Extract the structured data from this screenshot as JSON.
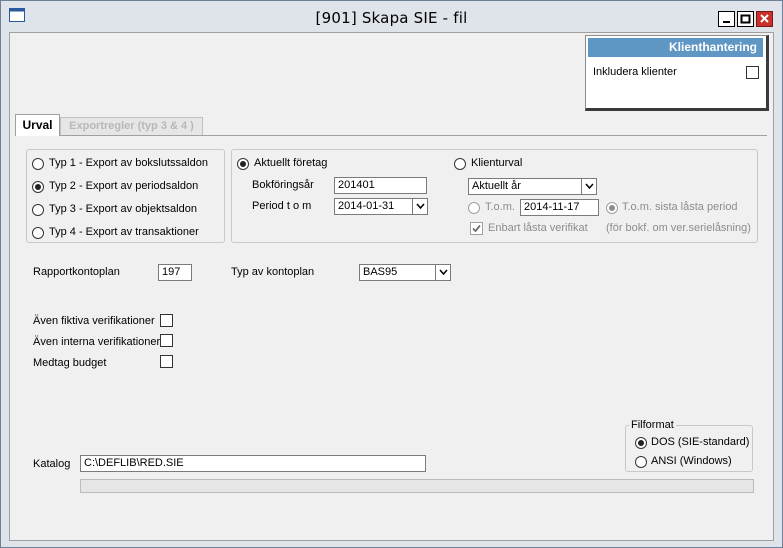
{
  "window": {
    "title": "[901]  Skapa SIE - fil"
  },
  "klient": {
    "header": "Klienthantering",
    "include_label": "Inkludera klienter"
  },
  "tabs": [
    {
      "label": "Urval"
    },
    {
      "label": "Exportregler (typ 3 & 4 )"
    }
  ],
  "types": [
    {
      "label": "Typ 1 - Export av bokslutssaldon",
      "selected": false
    },
    {
      "label": "Typ 2 - Export av periodsaldon",
      "selected": true
    },
    {
      "label": "Typ 3 - Export av objektsaldon",
      "selected": false
    },
    {
      "label": "Typ 4 - Export av transaktioner",
      "selected": false
    }
  ],
  "company": {
    "current_label": "Aktuellt företag",
    "year_label": "Bokföringsår",
    "year_value": "201401",
    "period_label": "Period t o m",
    "period_value": "2014-01-31",
    "client_label": "Klienturval",
    "client_select": "Aktuellt år",
    "tom_label": "T.o.m.",
    "tom_value": "2014-11-17",
    "tom_last_label": "T.o.m. sista låsta period",
    "locked_label": "Enbart låsta verifikat",
    "locked_note": "(för bokf. om ver.serielåsning)"
  },
  "plan": {
    "label": "Rapportkontoplan",
    "value": "197",
    "type_label": "Typ av kontoplan",
    "type_value": "BAS95"
  },
  "options": [
    {
      "label": "Även fiktiva verifikationer"
    },
    {
      "label": "Även interna verifikationer"
    },
    {
      "label": "Medtag budget"
    }
  ],
  "fileformat": {
    "legend": "Filformat",
    "options": [
      {
        "label": "DOS (SIE-standard)",
        "selected": true
      },
      {
        "label": "ANSI (Windows)",
        "selected": false
      }
    ]
  },
  "katalog": {
    "label": "Katalog",
    "value": "C:\\DEFLIB\\RED.SIE"
  }
}
